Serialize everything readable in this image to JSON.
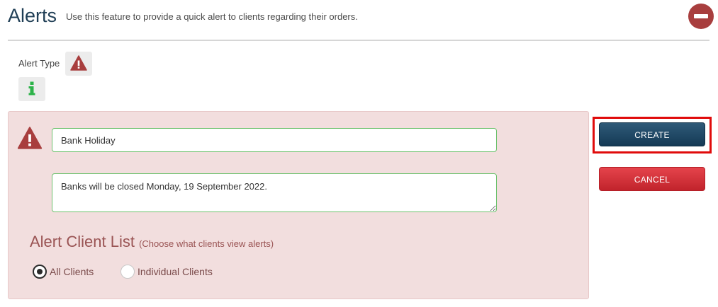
{
  "header": {
    "title": "Alerts",
    "subtitle": "Use this feature to provide a quick alert to clients regarding their orders."
  },
  "alert_type": {
    "label": "Alert Type",
    "options": [
      "warning-icon",
      "info-icon"
    ]
  },
  "form": {
    "title_value": "Bank Holiday",
    "message_value": "Banks will be closed Monday, 19 September 2022."
  },
  "client_list": {
    "title": "Alert Client List",
    "subtitle": "(Choose what clients view alerts)",
    "options": [
      {
        "label": "All Clients",
        "selected": true
      },
      {
        "label": "Individual Clients",
        "selected": false
      }
    ]
  },
  "actions": {
    "create_label": "CREATE",
    "cancel_label": "CANCEL"
  },
  "colors": {
    "accent": "#1f3e55",
    "warning": "#a83e3e",
    "info": "#2db34a",
    "panel_bg": "#f2dede",
    "create_button": "#1d4462",
    "cancel_button": "#d3323a",
    "highlight": "#e00b0b"
  }
}
